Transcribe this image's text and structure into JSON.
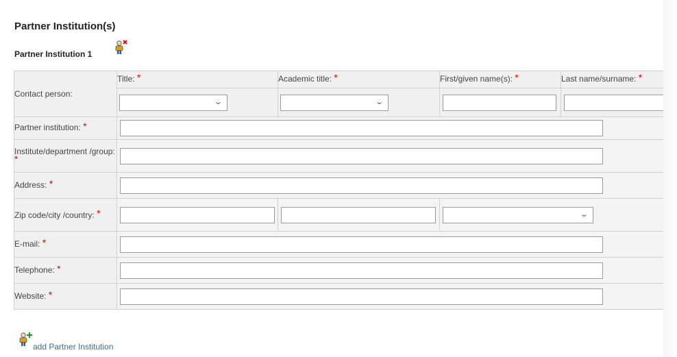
{
  "section": {
    "title": "Partner Institution(s)"
  },
  "partner": {
    "title": "Partner Institution 1"
  },
  "required_mark": "*",
  "icons": {
    "remove_partner": "person-remove-icon",
    "add_partner": "person-add-icon",
    "dropdown": "chevron-down-icon"
  },
  "contact": {
    "label": "Contact person:",
    "columns": [
      "Title:",
      "Academic title:",
      "First/given name(s):",
      "Last name/surname:"
    ]
  },
  "fields": {
    "institution": "Partner institution:",
    "department": "Institute/department /group:",
    "address": "Address:",
    "zip": "Zip code/city /country:",
    "email": "E-mail:",
    "telephone": "Telephone:",
    "website": "Website:"
  },
  "add_link": "add Partner Institution",
  "colors": {
    "required": "#e00000",
    "link": "#3d6a8e",
    "label_bg": "#f0f0f0",
    "border": "#d0d0d0"
  }
}
